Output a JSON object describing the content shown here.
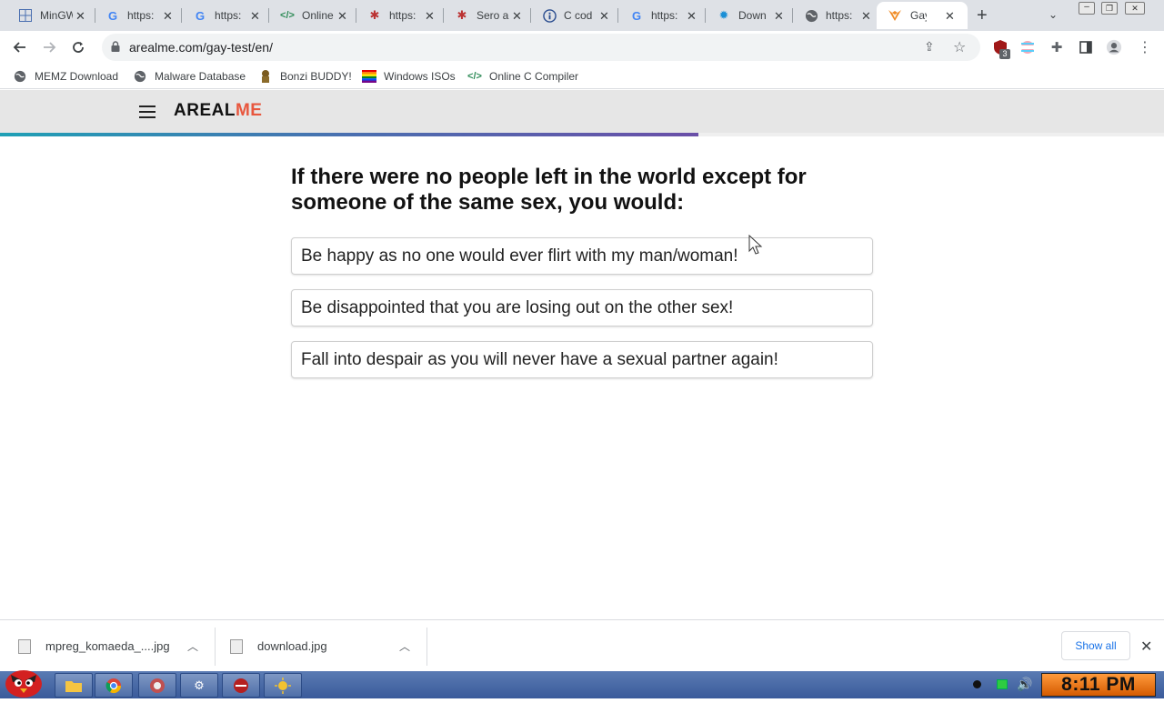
{
  "tabs": [
    {
      "title": "MinGW",
      "icon": "grid-icon"
    },
    {
      "title": "https:",
      "icon": "google-icon"
    },
    {
      "title": "https:",
      "icon": "google-icon"
    },
    {
      "title": "Online",
      "icon": "code-icon"
    },
    {
      "title": "https:",
      "icon": "bug-icon"
    },
    {
      "title": "Sero a",
      "icon": "bug-icon"
    },
    {
      "title": "C cod",
      "icon": "info-icon"
    },
    {
      "title": "https:",
      "icon": "google-icon"
    },
    {
      "title": "Down",
      "icon": "gear-icon"
    },
    {
      "title": "https:",
      "icon": "globe-icon"
    },
    {
      "title": "Gay T",
      "icon": "fox-icon"
    }
  ],
  "address": {
    "url": "arealme.com/gay-test/en/"
  },
  "bookmarks": [
    {
      "label": "MEMZ Download",
      "icon": "globe-icon"
    },
    {
      "label": "Malware Database",
      "icon": "globe-icon"
    },
    {
      "label": "Bonzi BUDDY!",
      "icon": "bonzi-icon"
    },
    {
      "label": "Windows ISOs",
      "icon": "windows-flag-icon"
    },
    {
      "label": "Online C Compiler",
      "icon": "code-icon"
    }
  ],
  "site": {
    "logo_part1": "AREAL",
    "logo_part2": "ME",
    "progress": 0.6
  },
  "quiz": {
    "question": "If there were no people left in the world except for someone of the same sex, you would:",
    "answers": [
      "Be happy as no one would ever flirt with my man/woman!",
      "Be disappointed that you are losing out on the other sex!",
      "Fall into despair as you will never have a sexual partner again!"
    ]
  },
  "downloads": {
    "items": [
      "mpreg_komaeda_....jpg",
      "download.jpg"
    ],
    "show_all": "Show all"
  },
  "taskbar": {
    "clock": "8:11 PM",
    "extension_badge": "3"
  },
  "colors": {
    "logo_accent": "#e8573e",
    "progress_start": "#1fa0b5",
    "progress_end": "#6a4fa8",
    "show_all_link": "#1a73e8"
  }
}
